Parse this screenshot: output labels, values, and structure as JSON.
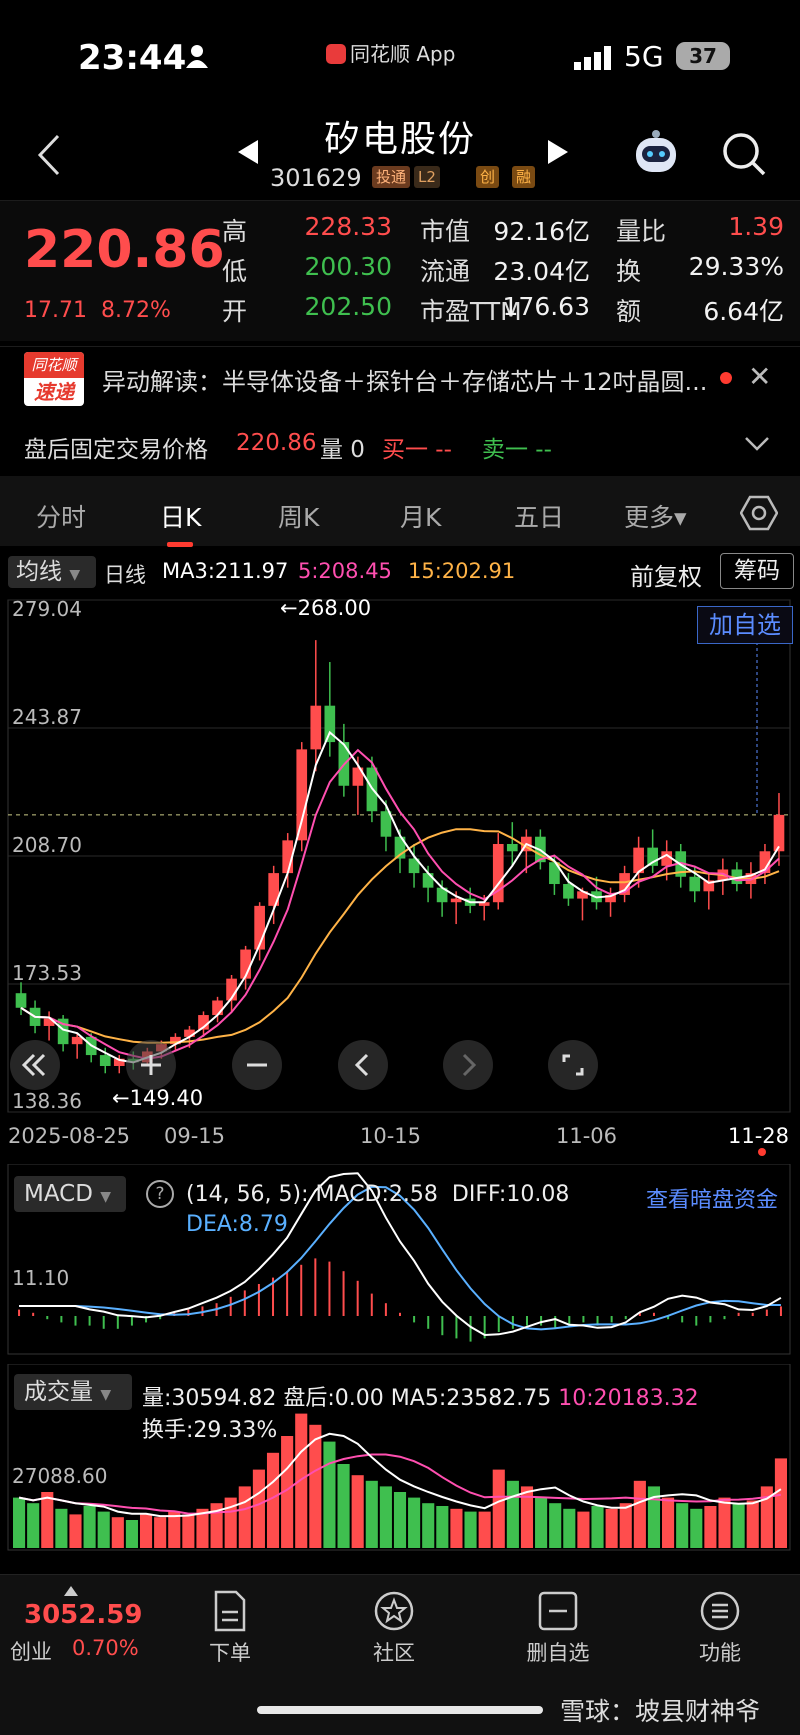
{
  "status_bar": {
    "time": "23:44",
    "app_name": "同花顺 App",
    "network": "5G",
    "battery": "37"
  },
  "header": {
    "stock_name": "矽电股份",
    "stock_code": "301629",
    "tags": [
      "投通",
      "L2",
      "创",
      "融"
    ]
  },
  "quote": {
    "price": "220.86",
    "change": "17.71",
    "change_pct": "8.72%",
    "rows": [
      {
        "l1": "高",
        "v1": "228.33",
        "c1": "red",
        "l2": "市值",
        "v2": "92.16亿",
        "l3": "量比",
        "v3": "1.39",
        "c3": "red"
      },
      {
        "l1": "低",
        "v1": "200.30",
        "c1": "green",
        "l2": "流通",
        "v2": "23.04亿",
        "l3": "换",
        "v3": "29.33%",
        "c3": "white"
      },
      {
        "l1": "开",
        "v1": "202.50",
        "c1": "green",
        "l2": "市盈TTM",
        "v2": "176.63",
        "l3": "额",
        "v3": "6.64亿",
        "c3": "white"
      }
    ]
  },
  "news": {
    "logo_top": "同花顺",
    "logo_bottom": "速递",
    "text": "异动解读：半导体设备＋探针台＋存储芯片＋12吋晶圆..."
  },
  "after_hours": {
    "label": "盘后固定交易价格",
    "price": "220.86",
    "vol": "量 0",
    "buy": "买一 --",
    "sell": "卖一 --"
  },
  "tabs": [
    "分时",
    "日K",
    "周K",
    "月K",
    "五日",
    "更多▾"
  ],
  "ma_bar": {
    "indicator": "均线",
    "period": "日线",
    "ma3": "MA3:211.97",
    "ma5": "5:208.45",
    "ma15": "15:202.91",
    "fq": "前复权",
    "chips": "筹码"
  },
  "kline": {
    "y_labels": [
      "279.04",
      "243.87",
      "208.70",
      "173.53",
      "138.36"
    ],
    "y_range": [
      138.36,
      279.04
    ],
    "high_note": "←268.00",
    "low_note": "←149.40",
    "add_watch": "加自选",
    "x_labels": [
      "2025-08-25",
      "09-15",
      "10-15",
      "11-06",
      "11-28"
    ],
    "colors": {
      "up": "#ff4d4d",
      "down": "#3fbf4f",
      "ma3": "#ffffff",
      "ma5": "#ff4fb0",
      "ma15": "#ffb347"
    }
  },
  "chart_data": [
    {
      "type": "candlestick",
      "title": "",
      "ylim": [
        138.36,
        279.04
      ],
      "x_ticks": [
        "2025-08-25",
        "09-15",
        "10-15",
        "11-06",
        "11-28"
      ],
      "ohlc": [
        [
          171,
          174,
          165,
          167
        ],
        [
          167,
          169,
          160,
          162
        ],
        [
          162,
          166,
          158,
          164
        ],
        [
          164,
          165,
          155,
          157
        ],
        [
          157,
          160,
          153,
          159
        ],
        [
          159,
          160,
          152,
          154
        ],
        [
          154,
          156,
          149,
          151
        ],
        [
          151,
          154,
          149,
          153
        ],
        [
          153,
          155,
          150,
          152
        ],
        [
          152,
          156,
          151,
          155
        ],
        [
          155,
          158,
          153,
          157
        ],
        [
          157,
          160,
          155,
          159
        ],
        [
          159,
          162,
          156,
          161
        ],
        [
          161,
          166,
          159,
          165
        ],
        [
          165,
          170,
          163,
          169
        ],
        [
          169,
          176,
          166,
          175
        ],
        [
          175,
          184,
          172,
          183
        ],
        [
          183,
          196,
          180,
          195
        ],
        [
          195,
          206,
          190,
          204
        ],
        [
          204,
          215,
          200,
          213
        ],
        [
          213,
          240,
          210,
          238
        ],
        [
          238,
          268,
          232,
          250
        ],
        [
          250,
          262,
          236,
          240
        ],
        [
          240,
          245,
          225,
          228
        ],
        [
          228,
          236,
          220,
          233
        ],
        [
          233,
          236,
          218,
          221
        ],
        [
          221,
          224,
          210,
          214
        ],
        [
          214,
          216,
          204,
          208
        ],
        [
          208,
          212,
          200,
          204
        ],
        [
          204,
          206,
          196,
          200
        ],
        [
          200,
          202,
          192,
          196
        ],
        [
          196,
          199,
          190,
          197
        ],
        [
          197,
          200,
          193,
          195
        ],
        [
          195,
          198,
          191,
          196
        ],
        [
          196,
          215,
          194,
          212
        ],
        [
          212,
          218,
          206,
          210
        ],
        [
          210,
          216,
          204,
          214
        ],
        [
          214,
          216,
          205,
          207
        ],
        [
          207,
          209,
          198,
          201
        ],
        [
          201,
          204,
          195,
          197
        ],
        [
          197,
          200,
          191,
          199
        ],
        [
          199,
          203,
          194,
          196
        ],
        [
          196,
          200,
          192,
          198
        ],
        [
          198,
          206,
          196,
          204
        ],
        [
          204,
          214,
          200,
          211
        ],
        [
          211,
          216,
          204,
          206
        ],
        [
          206,
          213,
          202,
          210
        ],
        [
          210,
          212,
          200,
          203
        ],
        [
          203,
          206,
          196,
          199
        ],
        [
          199,
          204,
          194,
          202
        ],
        [
          202,
          208,
          198,
          205
        ],
        [
          205,
          207,
          199,
          201
        ],
        [
          201,
          207,
          197,
          204
        ],
        [
          204,
          212,
          201,
          210
        ],
        [
          210,
          226,
          206,
          220
        ]
      ]
    },
    {
      "type": "bar",
      "title": "MACD",
      "params": "(14, 56, 5):",
      "macd": "MACD:2.58",
      "diff": "DIFF:10.08",
      "dea": "DEA:8.79",
      "y_label": "11.10",
      "histogram": [
        2,
        1,
        -1,
        -2,
        -3,
        -3,
        -4,
        -4,
        -3,
        -2,
        -1,
        1,
        2,
        3,
        4,
        6,
        8,
        10,
        12,
        14,
        16,
        18,
        17,
        14,
        11,
        7,
        4,
        1,
        -2,
        -4,
        -6,
        -7,
        -8,
        -7,
        -5,
        -4,
        -3,
        -3,
        -4,
        -3,
        -2,
        -3,
        -2,
        -1,
        1,
        1,
        -1,
        -2,
        -3,
        -2,
        -1,
        1,
        1,
        2,
        3
      ],
      "link": "查看暗盘资金"
    },
    {
      "type": "bar",
      "title": "成交量",
      "vol": "量:30594.82",
      "after": "盘后:0.00",
      "ma5": "MA5:23582.75",
      "ma10": "10:20183.32",
      "turnover": "换手:29.33%",
      "y_label": "27088.60",
      "values": [
        18,
        16,
        20,
        14,
        12,
        15,
        13,
        11,
        10,
        12,
        11,
        13,
        12,
        14,
        16,
        18,
        22,
        28,
        34,
        40,
        48,
        44,
        38,
        30,
        26,
        24,
        22,
        20,
        18,
        16,
        15,
        14,
        13,
        13,
        28,
        24,
        22,
        18,
        16,
        14,
        13,
        15,
        14,
        16,
        24,
        22,
        18,
        16,
        14,
        15,
        18,
        16,
        17,
        22,
        32
      ],
      "up": [
        0,
        0,
        1,
        0,
        1,
        0,
        0,
        1,
        0,
        1,
        1,
        1,
        1,
        1,
        1,
        1,
        1,
        1,
        1,
        1,
        1,
        1,
        0,
        0,
        1,
        0,
        0,
        0,
        0,
        0,
        0,
        1,
        0,
        1,
        1,
        0,
        1,
        0,
        0,
        0,
        1,
        0,
        1,
        1,
        1,
        0,
        1,
        0,
        0,
        1,
        1,
        0,
        1,
        1,
        1
      ]
    }
  ],
  "bottom_nav": {
    "index_value": "3052.59",
    "index_name": "创业",
    "index_pct": "0.70%",
    "items": [
      "下单",
      "社区",
      "删自选",
      "功能"
    ]
  },
  "watermark": "雪球：坡县财神爷"
}
